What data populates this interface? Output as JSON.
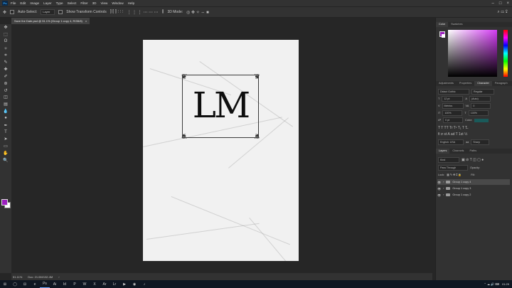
{
  "menubar": {
    "items": [
      "File",
      "Edit",
      "Image",
      "Layer",
      "Type",
      "Select",
      "Filter",
      "3D",
      "View",
      "Window",
      "Help"
    ],
    "app_icon": "Ps",
    "win_controls": [
      "–",
      "□",
      "×"
    ]
  },
  "options": {
    "auto_select_label": "Auto-Select:",
    "auto_select_value": "Layer",
    "transform_label": "Show Transform Controls",
    "mode_3d_label": "3D Mode:"
  },
  "document": {
    "tab_title": "Save the Date.psd @ 51.1% (Group 1 copy 4, RGB/8)",
    "close_glyph": "×",
    "monogram": "LM",
    "ornament_glyph": "❦"
  },
  "status": {
    "zoom": "51.11%",
    "doc_size": "Doc: 21.0M/132.4M",
    "arrow": "›"
  },
  "toolbar": {
    "tools": [
      "move-icon",
      "marquee-icon",
      "lasso-icon",
      "magic-wand-icon",
      "crop-icon",
      "eyedropper-icon",
      "healing-icon",
      "brush-icon",
      "stamp-icon",
      "history-brush-icon",
      "eraser-icon",
      "gradient-icon",
      "blur-icon",
      "dodge-icon",
      "pen-icon",
      "type-icon",
      "path-select-icon",
      "shape-icon",
      "hand-icon",
      "zoom-icon"
    ],
    "glyphs": [
      "✥",
      "⬚",
      "ʘ",
      "✧",
      "⌗",
      "✎",
      "✚",
      "✐",
      "⊛",
      "↺",
      "◫",
      "▤",
      "💧",
      "●",
      "✒",
      "T",
      "➤",
      "▭",
      "✋",
      "🔍"
    ],
    "fg_color": "#9c1fbf",
    "bg_color": "#ffffff"
  },
  "panels": {
    "color_tabs": [
      "Color",
      "Swatches"
    ],
    "text_tabs": [
      "Adjustments",
      "Properties",
      "Character",
      "Paragraph"
    ],
    "character": {
      "font_family": "Didact Gothic",
      "font_style": "Regular",
      "font_size": "12 pt",
      "leading": "(Auto)",
      "kerning": "Metrics",
      "tracking": "0",
      "v_scale": "100%",
      "h_scale": "100%",
      "baseline": "0 pt",
      "color_label": "Color:",
      "color": "#1a5a5a",
      "language": "English: USA",
      "antialias": "Sharp"
    },
    "layer_tabs": [
      "Layers",
      "Channels",
      "Paths"
    ],
    "layers_kind": "Kind",
    "blend_mode": "Pass Through",
    "opacity_label": "Opacity:",
    "lock_label": "Lock:",
    "fill_label": "Fill:",
    "layers": [
      {
        "name": "Group 1 copy 4",
        "selected": true
      },
      {
        "name": "Group 1 copy 3",
        "selected": false
      },
      {
        "name": "Group 1 copy 2",
        "selected": false
      }
    ],
    "eye_glyph": "👁",
    "collapse_glyph": "›"
  },
  "taskbar": {
    "apps": [
      "⊞",
      "◯",
      "⊟",
      "e",
      "Ps",
      "Ai",
      "Id",
      "P",
      "W",
      "X",
      "Ar",
      "Lr",
      "▶",
      "◉",
      "♪"
    ],
    "time": "01:29"
  }
}
